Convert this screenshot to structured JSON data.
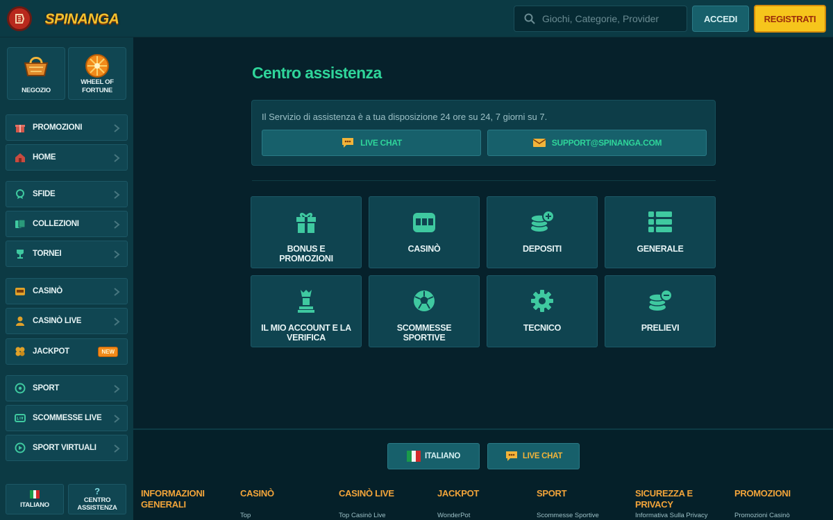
{
  "header": {
    "logo_text": "SPINANGA",
    "search_placeholder": "Giochi, Categorie, Provider",
    "login_label": "ACCEDI",
    "register_label": "REGISTRATI"
  },
  "sidebar": {
    "tiles": [
      {
        "label": "NEGOZIO",
        "icon": "basket-icon"
      },
      {
        "label": "WHEEL OF FORTUNE",
        "icon": "wheel-icon"
      }
    ],
    "items": [
      {
        "label": "PROMOZIONI",
        "icon": "gift-icon"
      },
      {
        "label": "HOME",
        "icon": "home-icon"
      },
      {
        "label": "SFIDE",
        "icon": "medal-icon"
      },
      {
        "label": "COLLEZIONI",
        "icon": "cards-icon"
      },
      {
        "label": "TORNEI",
        "icon": "trophy-icon"
      },
      {
        "label": "CASINÒ",
        "icon": "slot-icon"
      },
      {
        "label": "CASINÒ LIVE",
        "icon": "dealer-icon"
      },
      {
        "label": "JACKPOT",
        "icon": "jackpot-icon",
        "badge": "NEW"
      },
      {
        "label": "SPORT",
        "icon": "ball-icon"
      },
      {
        "label": "SCOMMESSE LIVE",
        "icon": "live-icon"
      },
      {
        "label": "SPORT VIRTUALI",
        "icon": "virtual-icon"
      }
    ],
    "bottom": {
      "language_label": "ITALIANO",
      "help_label": "CENTRO ASSISTENZA"
    }
  },
  "main": {
    "title": "Centro assistenza",
    "info_text": "Il Servizio di assistenza è a tua disposizione 24 ore su 24, 7 giorni su 7.",
    "live_chat_label": "LIVE CHAT",
    "email_label": "SUPPORT@SPINANGA.COM",
    "categories": [
      {
        "label": "BONUS E PROMOZIONI",
        "icon": "gift-icon"
      },
      {
        "label": "CASINÒ",
        "icon": "slot-machine-icon"
      },
      {
        "label": "DEPOSITI",
        "icon": "coins-plus-icon"
      },
      {
        "label": "GENERALE",
        "icon": "list-icon"
      },
      {
        "label": "IL MIO ACCOUNT E LA VERIFICA",
        "icon": "chess-piece-icon"
      },
      {
        "label": "SCOMMESSE SPORTIVE",
        "icon": "football-icon"
      },
      {
        "label": "TECNICO",
        "icon": "gear-icon"
      },
      {
        "label": "PRELIEVI",
        "icon": "coins-minus-icon"
      }
    ]
  },
  "footer": {
    "language_label": "ITALIANO",
    "live_chat_label": "LIVE CHAT",
    "columns": [
      {
        "title": "INFORMAZIONI GENERALI",
        "link": ""
      },
      {
        "title": "CASINÒ",
        "link": "Top"
      },
      {
        "title": "CASINÒ LIVE",
        "link": "Top Casinò Live"
      },
      {
        "title": "JACKPOT",
        "link": "WonderPot"
      },
      {
        "title": "SPORT",
        "link": "Scommesse Sportive"
      },
      {
        "title": "SICUREZZA E PRIVACY",
        "link": "Informativa Sulla Privacy"
      },
      {
        "title": "PROMOZIONI",
        "link": "Promozioni Casinò"
      }
    ]
  },
  "colors": {
    "accent_green": "#2fd59a",
    "accent_yellow": "#f6c51c",
    "footer_heading": "#f2a43a",
    "background": "#06212b"
  }
}
